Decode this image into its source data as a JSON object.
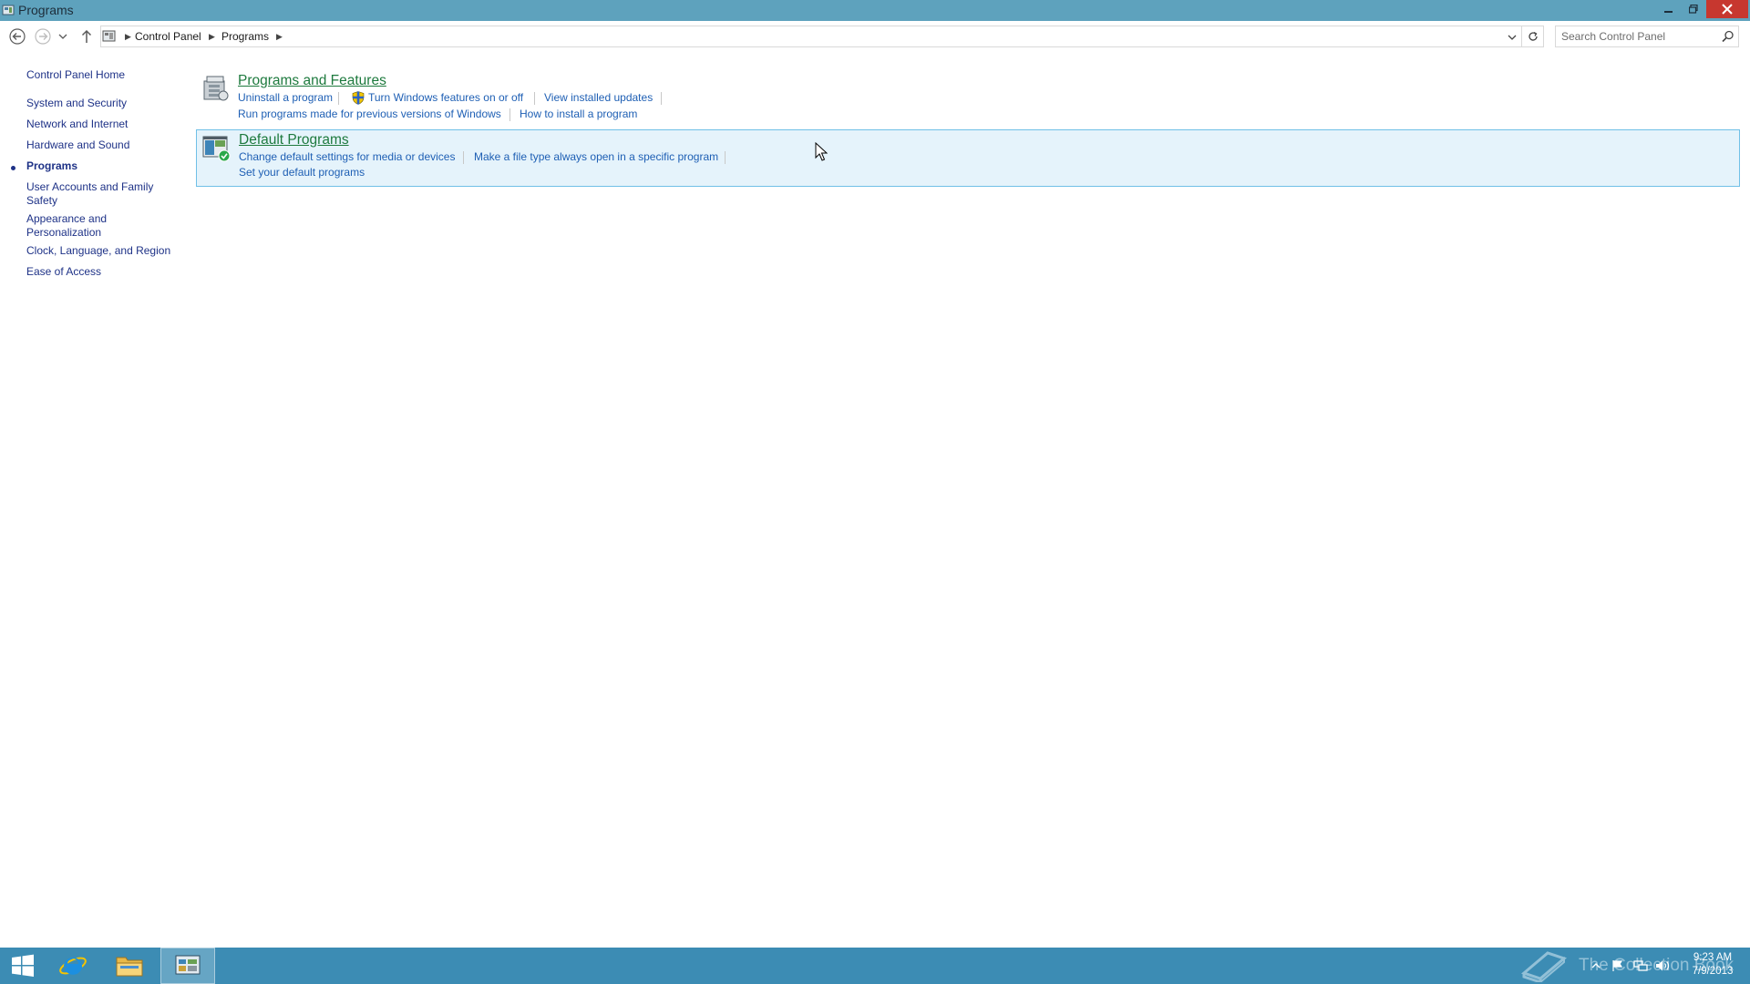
{
  "window": {
    "title": "Programs"
  },
  "address_bar": {
    "breadcrumbs": [
      "Control Panel",
      "Programs"
    ],
    "search_placeholder": "Search Control Panel"
  },
  "left_nav": {
    "home": "Control Panel Home",
    "items": [
      {
        "label": "System and Security",
        "current": false
      },
      {
        "label": "Network and Internet",
        "current": false
      },
      {
        "label": "Hardware and Sound",
        "current": false
      },
      {
        "label": "Programs",
        "current": true
      },
      {
        "label": "User Accounts and Family Safety",
        "current": false
      },
      {
        "label": "Appearance and Personalization",
        "current": false
      },
      {
        "label": "Clock, Language, and Region",
        "current": false
      },
      {
        "label": "Ease of Access",
        "current": false
      }
    ]
  },
  "categories": [
    {
      "title": "Programs and Features",
      "icon": "programs-features-icon",
      "tasks": [
        "Uninstall a program",
        "Turn Windows features on or off",
        "View installed updates",
        "Run programs made for previous versions of Windows",
        "How to install a program"
      ]
    },
    {
      "title": "Default Programs",
      "icon": "default-programs-icon",
      "tasks": [
        "Change default settings for media or devices",
        "Make a file type always open in a specific program",
        "Set your default programs"
      ]
    }
  ],
  "taskbar": {
    "watermark": "The Collection Book",
    "clock": {
      "time": "9:23 AM",
      "date": "7/9/2013"
    }
  },
  "colors": {
    "titlebar": "#5ea2bd",
    "taskbar": "#3c8cb4",
    "category_title": "#1e7a3e",
    "link": "#1e5fb4",
    "hover_bg": "#e5f3fb",
    "close_button": "#c7372f"
  }
}
